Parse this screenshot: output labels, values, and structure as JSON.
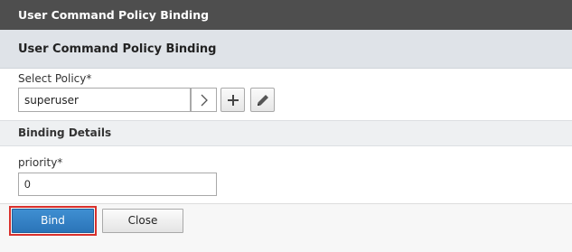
{
  "window": {
    "title": "User Command Policy Binding"
  },
  "section": {
    "title": "User Command Policy Binding"
  },
  "policy": {
    "label": "Select Policy*",
    "value": "superuser",
    "chevron_icon": "chevron-right-icon",
    "add_icon": "plus-icon",
    "edit_icon": "pencil-icon"
  },
  "binding_details": {
    "title": "Binding Details",
    "priority_label": "priority*",
    "priority_value": "0"
  },
  "footer": {
    "bind_label": "Bind",
    "close_label": "Close"
  },
  "colors": {
    "titlebar": "#4e4e4e",
    "section_header": "#dfe3e8",
    "primary_button": "#2f7fc4",
    "highlight": "#d9302c"
  }
}
